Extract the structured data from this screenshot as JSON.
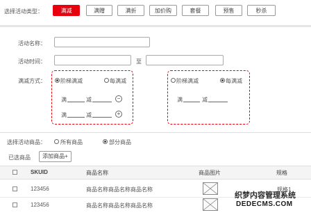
{
  "activity_type": {
    "label": "选择活动类型：",
    "options": [
      "满减",
      "满赠",
      "满折",
      "加价购",
      "套餐",
      "预售",
      "秒杀"
    ],
    "selected": "满减",
    "accent": "#e8000e"
  },
  "form": {
    "name_label": "活动名称：",
    "name_value": "",
    "time_label": "活动时间：",
    "start_value": "",
    "time_separator": "至",
    "end_value": "",
    "mode_label": "满减方式："
  },
  "rule_boxes": [
    {
      "option_tiered": "阶梯满减",
      "option_each": "每满减",
      "selected": "阶梯满减",
      "rows": [
        {
          "prefix": "满",
          "mid": "减",
          "action": "remove"
        },
        {
          "prefix": "满",
          "mid": "减",
          "action": "add"
        }
      ]
    },
    {
      "option_tiered": "阶梯满减",
      "option_each": "每满减",
      "selected": "每满减",
      "rows": [
        {
          "prefix": "满",
          "mid": "减"
        }
      ]
    }
  ],
  "products": {
    "select_label": "选择活动商品：",
    "option_all": "所有商品",
    "option_part": "部分商品",
    "selected": "部分商品",
    "selected_label": "已选商品",
    "add_button": "添加商品+",
    "table": {
      "headers": [
        "SKUID",
        "商品名称",
        "商品图片",
        "规格"
      ],
      "rows": [
        {
          "skuid": "123456",
          "name": "商品名称商品名称商品名称",
          "spec": "规格1"
        },
        {
          "skuid": "123456",
          "name": "商品名称商品名称商品名称",
          "spec": ""
        }
      ]
    }
  },
  "watermark": {
    "line1": "织梦内容管理系统",
    "line2": "DEDECMS.COM"
  },
  "icons": {
    "minus": "−",
    "plus": "+"
  }
}
